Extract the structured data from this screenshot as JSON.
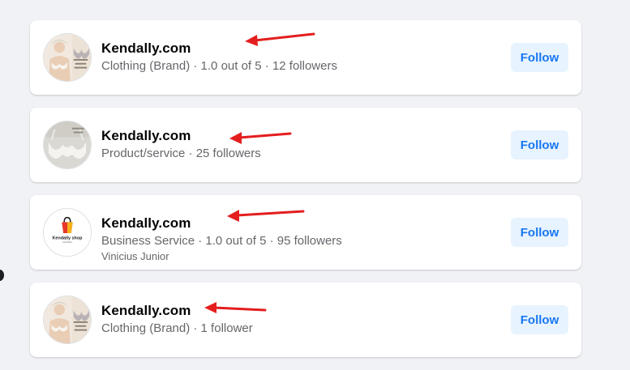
{
  "colors": {
    "background": "#f0f2f5",
    "card": "#ffffff",
    "name_text": "#050505",
    "meta_text": "#65676b",
    "follow_bg": "#e7f3ff",
    "follow_text": "#1877f2",
    "arrow": "#e41e1e"
  },
  "results": [
    {
      "name": "Kendally.com",
      "meta": "Clothing (Brand) · 1.0 out of 5 · 12 followers",
      "sub": "",
      "follow_label": "Follow",
      "avatar_icon": "model-with-bra-photo-icon"
    },
    {
      "name": "Kendally.com",
      "meta": "Product/service · 25 followers",
      "sub": "",
      "follow_label": "Follow",
      "avatar_icon": "bra-product-photo-icon"
    },
    {
      "name": "Kendally.com",
      "meta": "Business Service · 1.0 out of 5 · 95 followers",
      "sub": "Vinicius Junior",
      "follow_label": "Follow",
      "avatar_icon": "kendally-shop-logo-icon",
      "logo_text": "Kendally shop"
    },
    {
      "name": "Kendally.com",
      "meta": "Clothing (Brand) · 1 follower",
      "sub": "",
      "follow_label": "Follow",
      "avatar_icon": "model-with-bra-photo-icon"
    }
  ],
  "annotations": {
    "arrow_icon": "red-arrow-icon",
    "count": 4
  }
}
